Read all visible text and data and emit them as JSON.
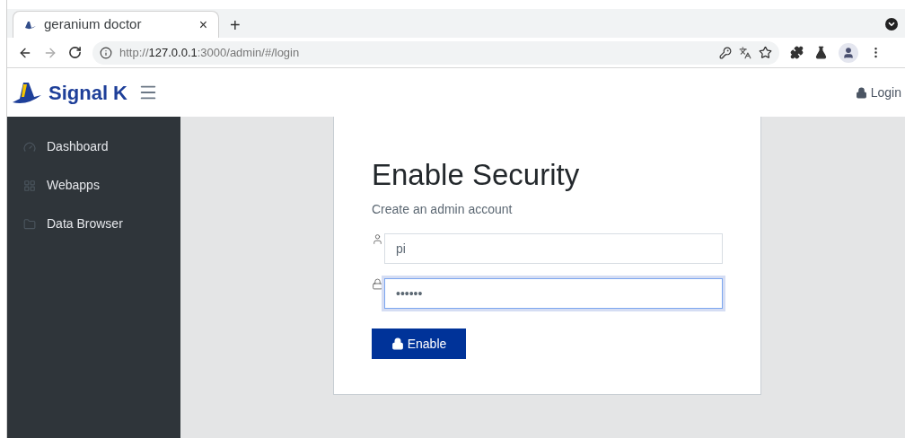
{
  "browser": {
    "tab": {
      "title": "geranium doctor",
      "close": "×"
    },
    "new_tab": "+",
    "url": {
      "host": "127.0.0.1",
      "before": "http://",
      "after": ":3000/admin/#/login"
    }
  },
  "header": {
    "brand": "Signal K",
    "login": "Login"
  },
  "sidebar": {
    "items": [
      {
        "kind": "dashboard",
        "label": "Dashboard",
        "selected": false
      },
      {
        "kind": "webapps",
        "label": "Webapps",
        "selected": false
      },
      {
        "kind": "browser",
        "label": "Data Browser",
        "selected": false
      }
    ]
  },
  "form": {
    "title": "Enable Security",
    "subtitle": "Create an admin account",
    "fields": [
      {
        "kind": "user",
        "value": "pi",
        "focused": false
      },
      {
        "kind": "password",
        "value": "••••••",
        "focused": true
      }
    ],
    "button": "Enable"
  }
}
